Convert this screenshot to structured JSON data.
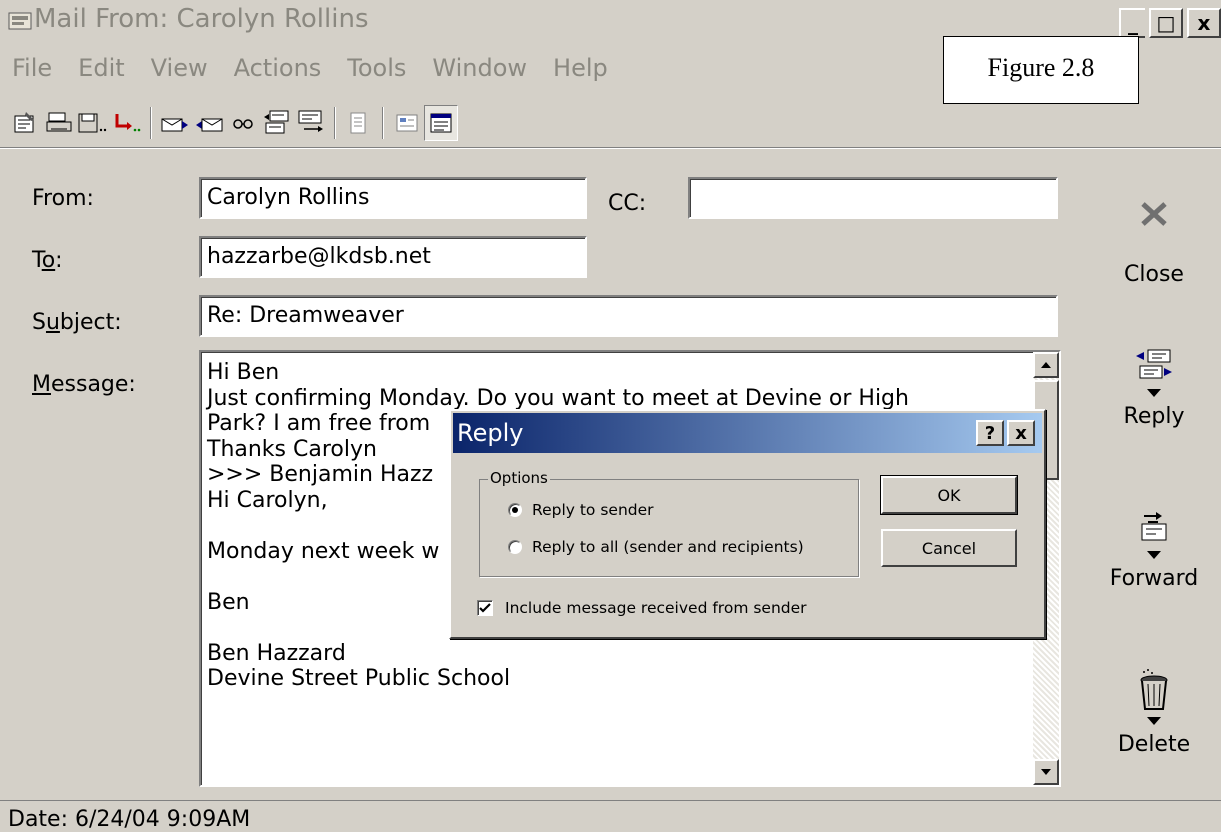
{
  "window": {
    "title": "Mail From: Carolyn Rollins",
    "controls": [
      "_",
      "□",
      "x"
    ]
  },
  "figure_label": "Figure 2.8",
  "menu": [
    "File",
    "Edit",
    "View",
    "Actions",
    "Tools",
    "Window",
    "Help"
  ],
  "toolbar": {
    "icons": [
      "properties-icon",
      "print-icon",
      "save-icon",
      "move-icon",
      "previous-icon",
      "next-icon",
      "find-icon",
      "reply-toolbar-icon",
      "forward-toolbar-icon",
      "details-icon",
      "view-icon",
      "preview-icon"
    ]
  },
  "form": {
    "from_label": "From:",
    "from_value": "Carolyn Rollins",
    "cc_label": "CC:",
    "cc_value": "",
    "to_label_pre": "T",
    "to_label_ul": "o",
    "to_label_post": ":",
    "to_value": "hazzarbe@lkdsb.net",
    "subject_label_pre": "S",
    "subject_label_ul": "u",
    "subject_label_post": "bject:",
    "subject_value": "Re: Dreamweaver",
    "message_label_ul": "M",
    "message_label_post": "essage:",
    "message_lines": [
      "Hi Ben",
      "Just confirming Monday. Do you want to meet at Devine or High",
      "Park? I am free from",
      "Thanks Carolyn",
      ">>> Benjamin Hazz",
      "Hi Carolyn,",
      "",
      "Monday next week w",
      "",
      "Ben",
      "",
      "Ben Hazzard",
      "Devine Street Public School"
    ]
  },
  "actions": {
    "close": "Close",
    "reply": "Reply",
    "forward": "Forward",
    "delete": "Delete"
  },
  "status": {
    "text": "Date: 6/24/04 9:09AM"
  },
  "dialog": {
    "title": "Reply",
    "help_btn": "?",
    "close_btn": "x",
    "group_label": "Options",
    "option_sender": "Reply to sender",
    "option_all": "Reply to all (sender and recipients)",
    "selected_option": "sender",
    "include_label": "Include message received from sender",
    "include_checked": true,
    "ok_label": "OK",
    "cancel_label": "Cancel"
  }
}
